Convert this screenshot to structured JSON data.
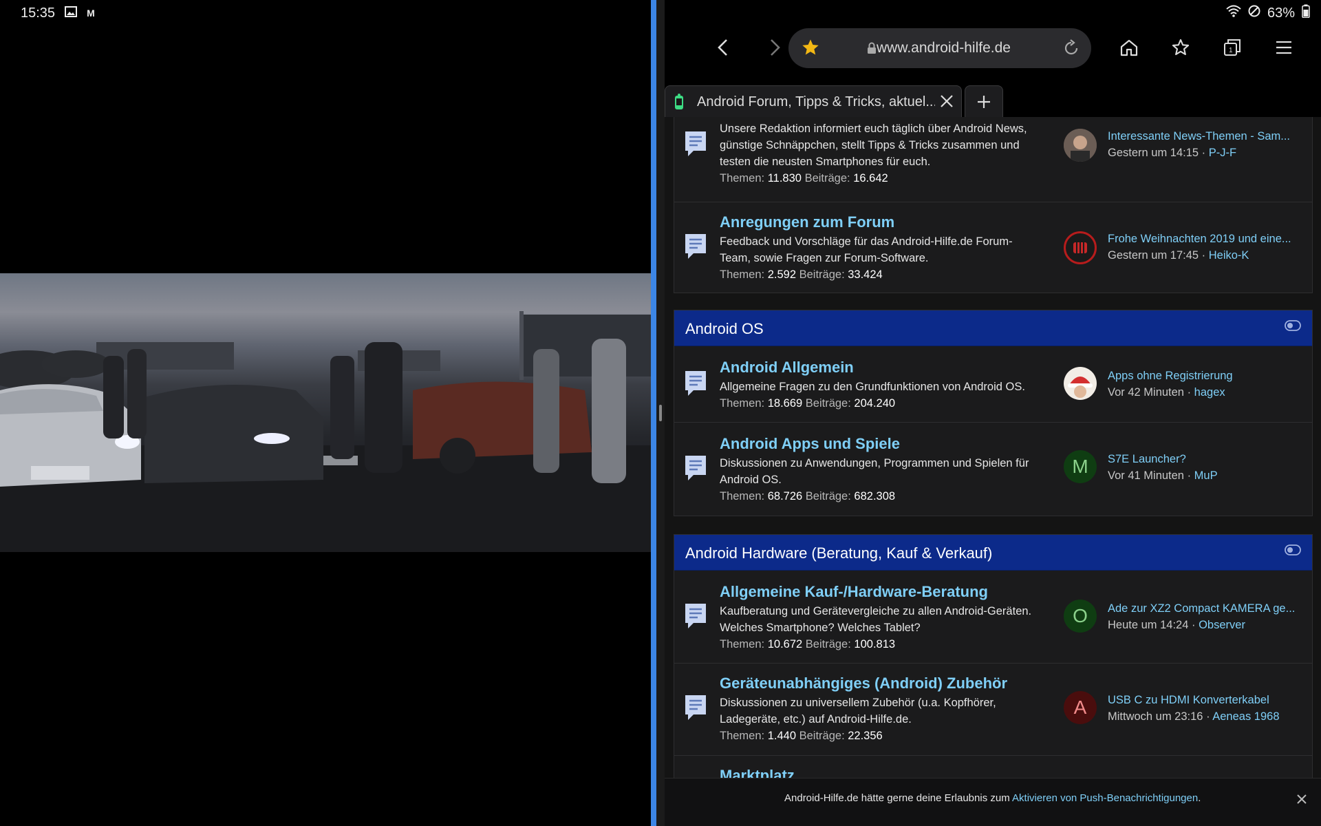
{
  "status": {
    "time": "15:35",
    "notif_m": "M",
    "battery": "63%"
  },
  "browser": {
    "url": "www.android-hilfe.de",
    "tab_title": "Android Forum, Tipps & Tricks, aktuel..."
  },
  "forum": {
    "stats_label_topics": "Themen:",
    "stats_label_posts": "Beiträge:",
    "nodes_top": [
      {
        "title": "",
        "desc": "Unsere Redaktion informiert euch täglich über Android News, günstige Schnäppchen, stellt Tipps & Tricks zusammen und testen die neusten Smartphones für euch.",
        "topics": "11.830",
        "posts": "16.642",
        "last_title": "Interessante News-Themen - Sam...",
        "last_time": "Gestern um 14:15",
        "last_user": "P-J-F",
        "avatar_letter": ""
      },
      {
        "title": "Anregungen zum Forum",
        "desc": "Feedback und Vorschläge für das Android-Hilfe.de Forum-Team, sowie Fragen zur Forum-Software.",
        "topics": "2.592",
        "posts": "33.424",
        "last_title": "Frohe Weihnachten 2019 und eine...",
        "last_time": "Gestern um 17:45",
        "last_user": "Heiko-K",
        "avatar_letter": ""
      }
    ],
    "category_os": {
      "title": "Android OS",
      "nodes": [
        {
          "title": "Android Allgemein",
          "desc": "Allgemeine Fragen zu den Grundfunktionen von Android OS.",
          "topics": "18.669",
          "posts": "204.240",
          "last_title": "Apps ohne Registrierung",
          "last_time": "Vor 42 Minuten",
          "last_user": "hagex",
          "avatar_letter": ""
        },
        {
          "title": "Android Apps und Spiele",
          "desc": "Diskussionen zu Anwendungen, Programmen und Spielen für Android OS.",
          "topics": "68.726",
          "posts": "682.308",
          "last_title": "S7E Launcher?",
          "last_time": "Vor 41 Minuten",
          "last_user": "MuP",
          "avatar_letter": "M"
        }
      ]
    },
    "category_hw": {
      "title": "Android Hardware (Beratung, Kauf & Verkauf)",
      "nodes": [
        {
          "title": "Allgemeine Kauf-/Hardware-Beratung",
          "desc": "Kaufberatung und Gerätevergleiche zu allen Android-Geräten. Welches Smartphone? Welches Tablet?",
          "topics": "10.672",
          "posts": "100.813",
          "last_title": "Ade zur XZ2 Compact KAMERA ge...",
          "last_time": "Heute um 14:24",
          "last_user": "Observer",
          "avatar_letter": "O"
        },
        {
          "title": "Geräteunabhängiges (Android) Zubehör",
          "desc": "Diskussionen zu universellem Zubehör (u.a. Kopfhörer, Ladegeräte, etc.) auf Android-Hilfe.de.",
          "topics": "1.440",
          "posts": "22.356",
          "last_title": "USB C zu HDMI Konverterkabel",
          "last_time": "Mittwoch um 23:16",
          "last_user": "Aeneas 1968",
          "avatar_letter": "A"
        }
      ],
      "next_title": "Marktplatz"
    },
    "meta_sep": " · "
  },
  "push_notice": {
    "text": "Android-Hilfe.de hätte gerne deine Erlaubnis zum ",
    "link": "Aktivieren von Push-Benachrichtigungen",
    "suffix": "."
  },
  "colors": {
    "accent_link": "#7fcff7",
    "category_header": "#0c2a8a",
    "split_divider": "#3c86e6"
  }
}
